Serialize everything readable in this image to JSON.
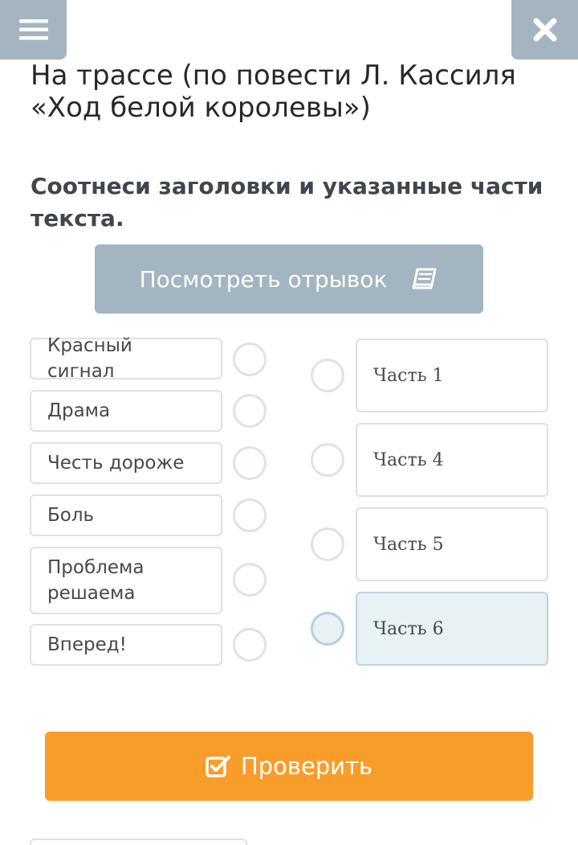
{
  "header": {
    "menu_icon": "hamburger-menu-icon",
    "close_icon": "close-x-icon",
    "title": "На трассе (по повести Л. Кассиля «Ход белой королевы»)",
    "instruction": "Соотнеси заголовки и указанные части текста."
  },
  "view_excerpt": {
    "label": "Посмотреть отрывок",
    "icon": "book-icon"
  },
  "left_items": [
    {
      "label": "Красный сигнал"
    },
    {
      "label": "Драма"
    },
    {
      "label": "Честь дороже"
    },
    {
      "label": "Боль"
    },
    {
      "label": "Проблема решаема"
    },
    {
      "label": "Вперед!"
    }
  ],
  "right_items": [
    {
      "label": "Часть 1",
      "selected": false
    },
    {
      "label": "Часть 4",
      "selected": false
    },
    {
      "label": "Часть 5",
      "selected": false
    },
    {
      "label": "Часть 6",
      "selected": true
    }
  ],
  "check_button": {
    "label": "Проверить",
    "icon": "checkbox-check-icon"
  },
  "colors": {
    "accent_orange": "#f99d2a",
    "gray_button": "#a3b5c1",
    "selected_bg": "#e8f1f4"
  }
}
